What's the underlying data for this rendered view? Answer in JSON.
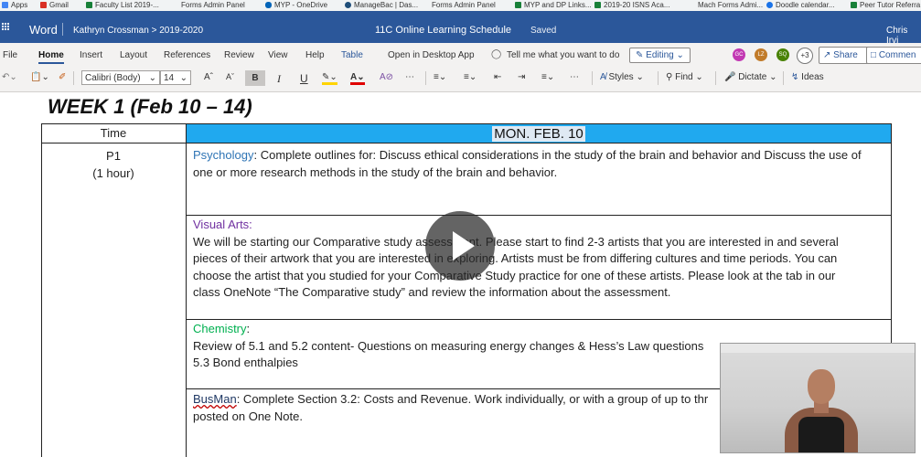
{
  "bookmarks": [
    {
      "label": "Apps",
      "color": "#4285f4"
    },
    {
      "label": "Gmail",
      "color": "#d93025"
    },
    {
      "label": "Faculty List 2019-...",
      "color": "#188038"
    },
    {
      "label": "Forms Admin Panel",
      "color": "#888888"
    },
    {
      "label": "MYP - OneDrive",
      "color": "#0364b8"
    },
    {
      "label": "ManageBac | Das...",
      "color": "#1f4e79"
    },
    {
      "label": "Forms Admin Panel",
      "color": "#888888"
    },
    {
      "label": "MYP and DP Links...",
      "color": "#188038"
    },
    {
      "label": "2019-20 ISNS Aca...",
      "color": "#188038"
    },
    {
      "label": "Mach Forms Admi...",
      "color": "#888888"
    },
    {
      "label": "Doodle calendar...",
      "color": "#1a73e8"
    },
    {
      "label": "Peer Tutor Referra...",
      "color": "#188038"
    }
  ],
  "titlebar": {
    "app": "Word",
    "breadcrumb": "Kathryn Crossman > 2019-2020",
    "doc_title": "11C Online Learning Schedule",
    "status": "Saved",
    "user": "Chris Irvi"
  },
  "ribbon": {
    "tabs": [
      "File",
      "Home",
      "Insert",
      "Layout",
      "References",
      "Review",
      "View",
      "Help",
      "Table"
    ],
    "active_tab": "Home",
    "open_desktop": "Open in Desktop App",
    "tell_me": "Tell me what you want to do",
    "editing": "Editing",
    "avatars": [
      {
        "initials": "GC",
        "color": "#c239b3"
      },
      {
        "initials": "LZ",
        "color": "#c17b2a"
      },
      {
        "initials": "SQ",
        "color": "#498205"
      }
    ],
    "more_count": "+3",
    "share": "Share",
    "comments": "Commen"
  },
  "format": {
    "font": "Calibri (Body)",
    "size": "14",
    "styles": "Styles",
    "find": "Find",
    "dictate": "Dictate",
    "ideas": "Ideas",
    "icons": [
      "undo-icon",
      "paste-icon",
      "format-painter-icon",
      "grow-font-icon",
      "shrink-font-icon",
      "bold-icon",
      "italic-icon",
      "underline-icon",
      "highlight-icon",
      "font-color-icon",
      "clear-format-icon",
      "bullets-icon",
      "numbering-icon",
      "decrease-indent-icon",
      "increase-indent-icon",
      "align-icon"
    ]
  },
  "document": {
    "heading": "WEEK 1 (Feb 10 – 14)",
    "time_header": "Time",
    "day_header": "MON. FEB. 10",
    "day_header_color": "#20a9ef",
    "period": "P1",
    "duration": "(1 hour)",
    "rows": [
      {
        "subject": "Psychology",
        "lines": [
          ": Complete outlines for: Discuss ethical considerations in the study of the brain and behavior and Discuss the use of",
          "one or more research methods in the study of the brain and behavior."
        ]
      },
      {
        "subject": "Visual Arts:",
        "lines": [
          "We will be starting our Comparative study assessment. Please start to find 2-3 artists that you are interested in and several",
          "pieces of their artwork that you are interested in exploring. Artists must be from differing cultures and time periods. You can",
          "choose the artist that you studied for your Comparative Study practice for one of these artists. Please look at the tab in our",
          "class OneNote “The Comparative study” and review the information about the assessment."
        ]
      },
      {
        "subject": "Chemistry",
        "suffix": ":",
        "lines": [
          "Review of 5.1 and 5.2 content- Questions on measuring energy changes & Hess’s Law questions",
          "5.3 Bond enthalpies"
        ]
      },
      {
        "subject": "BusMan",
        "lines": [
          ": Complete Section 3.2: Costs and Revenue. Work individually, or with a group of up to thr",
          "posted on One Note."
        ]
      }
    ]
  }
}
